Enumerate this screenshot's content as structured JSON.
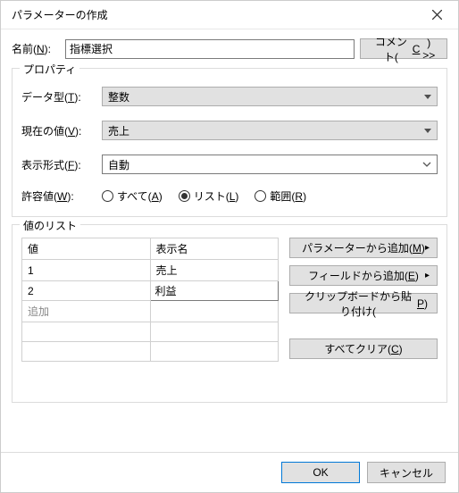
{
  "titlebar": {
    "title": "パラメーターの作成"
  },
  "name": {
    "label_pre": "名前(",
    "label_u": "N",
    "label_post": "):",
    "value": "指標選択"
  },
  "comment_btn": {
    "pre": "コメント(",
    "u": "C",
    "post": ") >>"
  },
  "properties": {
    "legend": "プロパティ",
    "datatype": {
      "label_pre": "データ型(",
      "label_u": "T",
      "label_post": "):",
      "value": "整数"
    },
    "current": {
      "label_pre": "現在の値(",
      "label_u": "V",
      "label_post": "):",
      "value": "売上"
    },
    "display": {
      "label_pre": "表示形式(",
      "label_u": "F",
      "label_post": "):",
      "value": "自動"
    },
    "allowed": {
      "label_pre": "許容値(",
      "label_u": "W",
      "label_post": "):",
      "opts": {
        "all": {
          "pre": "すべて(",
          "u": "A",
          "post": ")"
        },
        "list": {
          "pre": "リスト(",
          "u": "L",
          "post": ")"
        },
        "range": {
          "pre": "範囲(",
          "u": "R",
          "post": ")"
        }
      },
      "selected": "list"
    }
  },
  "valuelist": {
    "legend": "値のリスト",
    "headers": {
      "value": "値",
      "display": "表示名"
    },
    "rows": [
      {
        "value": "1",
        "display": "売上"
      },
      {
        "value": "2",
        "display": "利益"
      }
    ],
    "addrow": "追加",
    "side": {
      "from_param": {
        "pre": "パラメーターから追加(",
        "u": "M",
        "post": ")"
      },
      "from_field": {
        "pre": "フィールドから追加(",
        "u": "E",
        "post": ")"
      },
      "from_clip": {
        "pre": "クリップボードから貼り付け(",
        "u": "P",
        "post": ")"
      },
      "clear_all": {
        "pre": "すべてクリア(",
        "u": "C",
        "post": ")"
      }
    }
  },
  "footer": {
    "ok": "OK",
    "cancel": "キャンセル"
  }
}
